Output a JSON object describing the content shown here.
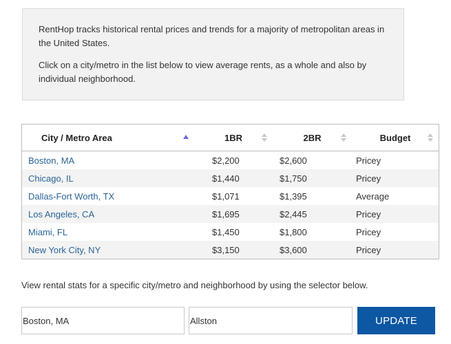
{
  "intro": {
    "paragraph1": "RentHop tracks historical rental prices and trends for a majority of metropolitan areas in the United States.",
    "paragraph2": "Click on a city/metro in the list below to view average rents, as a whole and also by individual neighborhood."
  },
  "table": {
    "headers": {
      "city": "City / Metro Area",
      "br1": "1BR",
      "br2": "2BR",
      "budget": "Budget"
    },
    "sorted_column": "city",
    "sort_direction": "ascending",
    "colors": {
      "sort_active": "#6b6bd6",
      "sort_inactive": "#c8c8c8",
      "link": "#2a6496",
      "stripe": "#f3f3f3"
    },
    "rows": [
      {
        "city": "Boston, MA",
        "br1": "$2,200",
        "br2": "$2,600",
        "budget": "Pricey"
      },
      {
        "city": "Chicago, IL",
        "br1": "$1,440",
        "br2": "$1,750",
        "budget": "Pricey"
      },
      {
        "city": "Dallas-Fort Worth, TX",
        "br1": "$1,071",
        "br2": "$1,395",
        "budget": "Average"
      },
      {
        "city": "Los Angeles, CA",
        "br1": "$1,695",
        "br2": "$2,445",
        "budget": "Pricey"
      },
      {
        "city": "Miami, FL",
        "br1": "$1,450",
        "br2": "$1,800",
        "budget": "Pricey"
      },
      {
        "city": "New York City, NY",
        "br1": "$3,150",
        "br2": "$3,600",
        "budget": "Pricey"
      }
    ]
  },
  "selector": {
    "note": "View rental stats for a specific city/metro and neighborhood by using the selector below.",
    "city_value": "Boston, MA",
    "neighborhood_value": "Allston",
    "update_label": "UPDATE",
    "button_color": "#0d57a3"
  }
}
